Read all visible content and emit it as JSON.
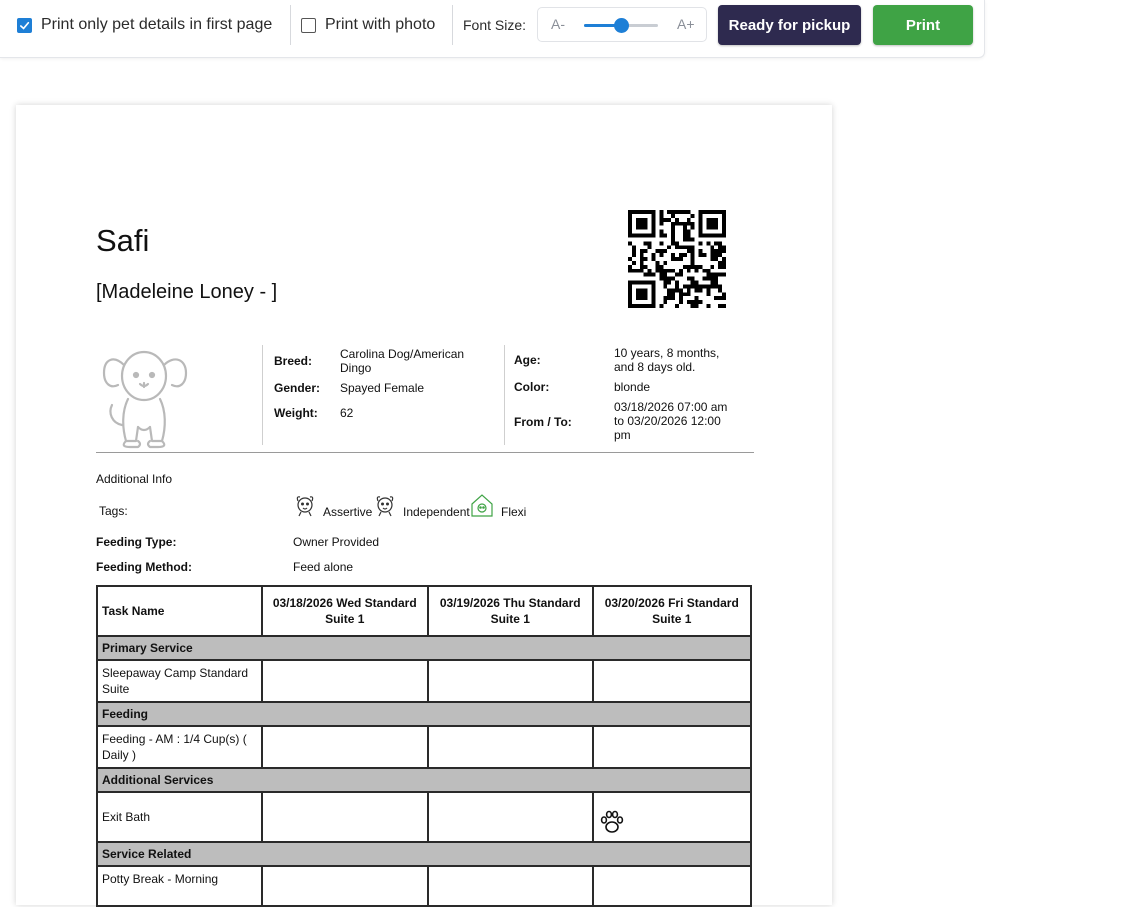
{
  "toolbar": {
    "print_first_page_label": "Print only pet details in first page",
    "print_first_page_checked": true,
    "print_photo_label": "Print with photo",
    "print_photo_checked": false,
    "font_size_label": "Font Size:",
    "font_decrease": "A-",
    "font_increase": "A+",
    "font_slider_value": 0.5,
    "ready_button": "Ready for pickup",
    "print_button": "Print"
  },
  "pet": {
    "name": "Safi",
    "owner": "[Madeleine Loney - ]",
    "details_left": [
      {
        "label": "Breed:",
        "value": "Carolina Dog/American Dingo"
      },
      {
        "label": "Gender:",
        "value": "Spayed Female"
      },
      {
        "label": "Weight:",
        "value": "62"
      }
    ],
    "details_right": [
      {
        "label": "Age:",
        "value": "10 years, 8 months, and 8 days old."
      },
      {
        "label": "Color:",
        "value": "blonde"
      },
      {
        "label": "From / To:",
        "value": "03/18/2026 07:00 am to 03/20/2026 12:00 pm"
      }
    ]
  },
  "additional": {
    "heading": "Additional Info",
    "tags_label": "Tags:",
    "tags": [
      {
        "name": "Assertive",
        "icon": "dog-face-icon"
      },
      {
        "name": "Independent",
        "icon": "dog-face-icon"
      },
      {
        "name": "Flexi",
        "icon": "dog-house-icon"
      }
    ],
    "feeding_type_label": "Feeding Type:",
    "feeding_type": "Owner Provided",
    "feeding_method_label": "Feeding Method:",
    "feeding_method": "Feed alone"
  },
  "table": {
    "headers": [
      "Task Name",
      "03/18/2026 Wed Standard Suite 1",
      "03/19/2026 Thu Standard Suite 1",
      "03/20/2026 Fri Standard Suite 1"
    ],
    "sections": [
      {
        "title": "Primary Service",
        "tasks": [
          "Sleepaway Camp Standard Suite"
        ]
      },
      {
        "title": "Feeding",
        "tasks": [
          "Feeding - AM : 1/4 Cup(s) ( Daily )"
        ]
      },
      {
        "title": "Additional Services",
        "tasks": [
          "Exit Bath"
        ]
      },
      {
        "title": "Service Related",
        "tasks": [
          "Potty Break - Morning"
        ]
      }
    ]
  },
  "colors": {
    "accent": "#1e7fd6",
    "pickup_button": "#2e2a4f",
    "print_button": "#3fa345",
    "section_bg": "#bdbdbd"
  }
}
